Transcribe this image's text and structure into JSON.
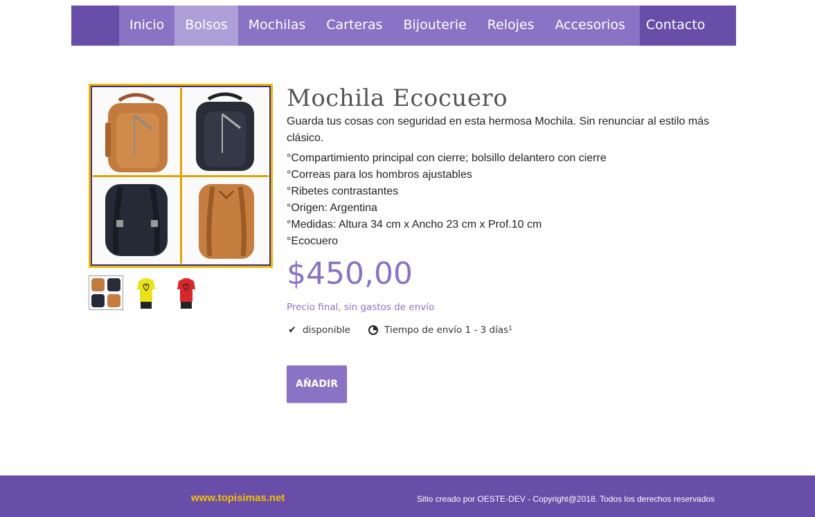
{
  "nav": {
    "items": [
      {
        "label": "Inicio"
      },
      {
        "label": "Bolsos"
      },
      {
        "label": "Mochilas"
      },
      {
        "label": "Carteras"
      },
      {
        "label": "Bijouterie"
      },
      {
        "label": "Relojes"
      },
      {
        "label": "Accesorios"
      },
      {
        "label": "Contacto"
      }
    ],
    "active": "Bolsos"
  },
  "product": {
    "title": "Mochila Ecocuero",
    "description": "Guarda tus cosas con seguridad en esta hermosa Mochila. Sin renunciar al estilo más clásico.",
    "features": [
      "°Compartimiento principal con cierre; bolsillo delantero con cierre",
      "°Correas para los hombros ajustables",
      "°Ribetes contrastantes",
      "°Origen: Argentina",
      "°Medidas: Altura 34 cm x Ancho 23 cm x Prof.10 cm",
      "°Ecocuero"
    ],
    "price": "$450,00",
    "price_note": "Precio final, sin gastos de envío",
    "availability": "disponible",
    "shipping": "Tiempo de envío 1 - 3 días",
    "shipping_sup": "1",
    "add_button": "AÑADIR"
  },
  "colors": {
    "nav_dark": "#684ea8",
    "nav_mid": "#8a72c5",
    "nav_active": "#ad9fd8",
    "accent": "#8a72c5",
    "footer_link": "#f2c200"
  },
  "footer": {
    "site": "www.topisimas.net",
    "copyright": "Sitio creado por OESTE-DEV - Copyright@2018. Todos los derechos reservados"
  }
}
